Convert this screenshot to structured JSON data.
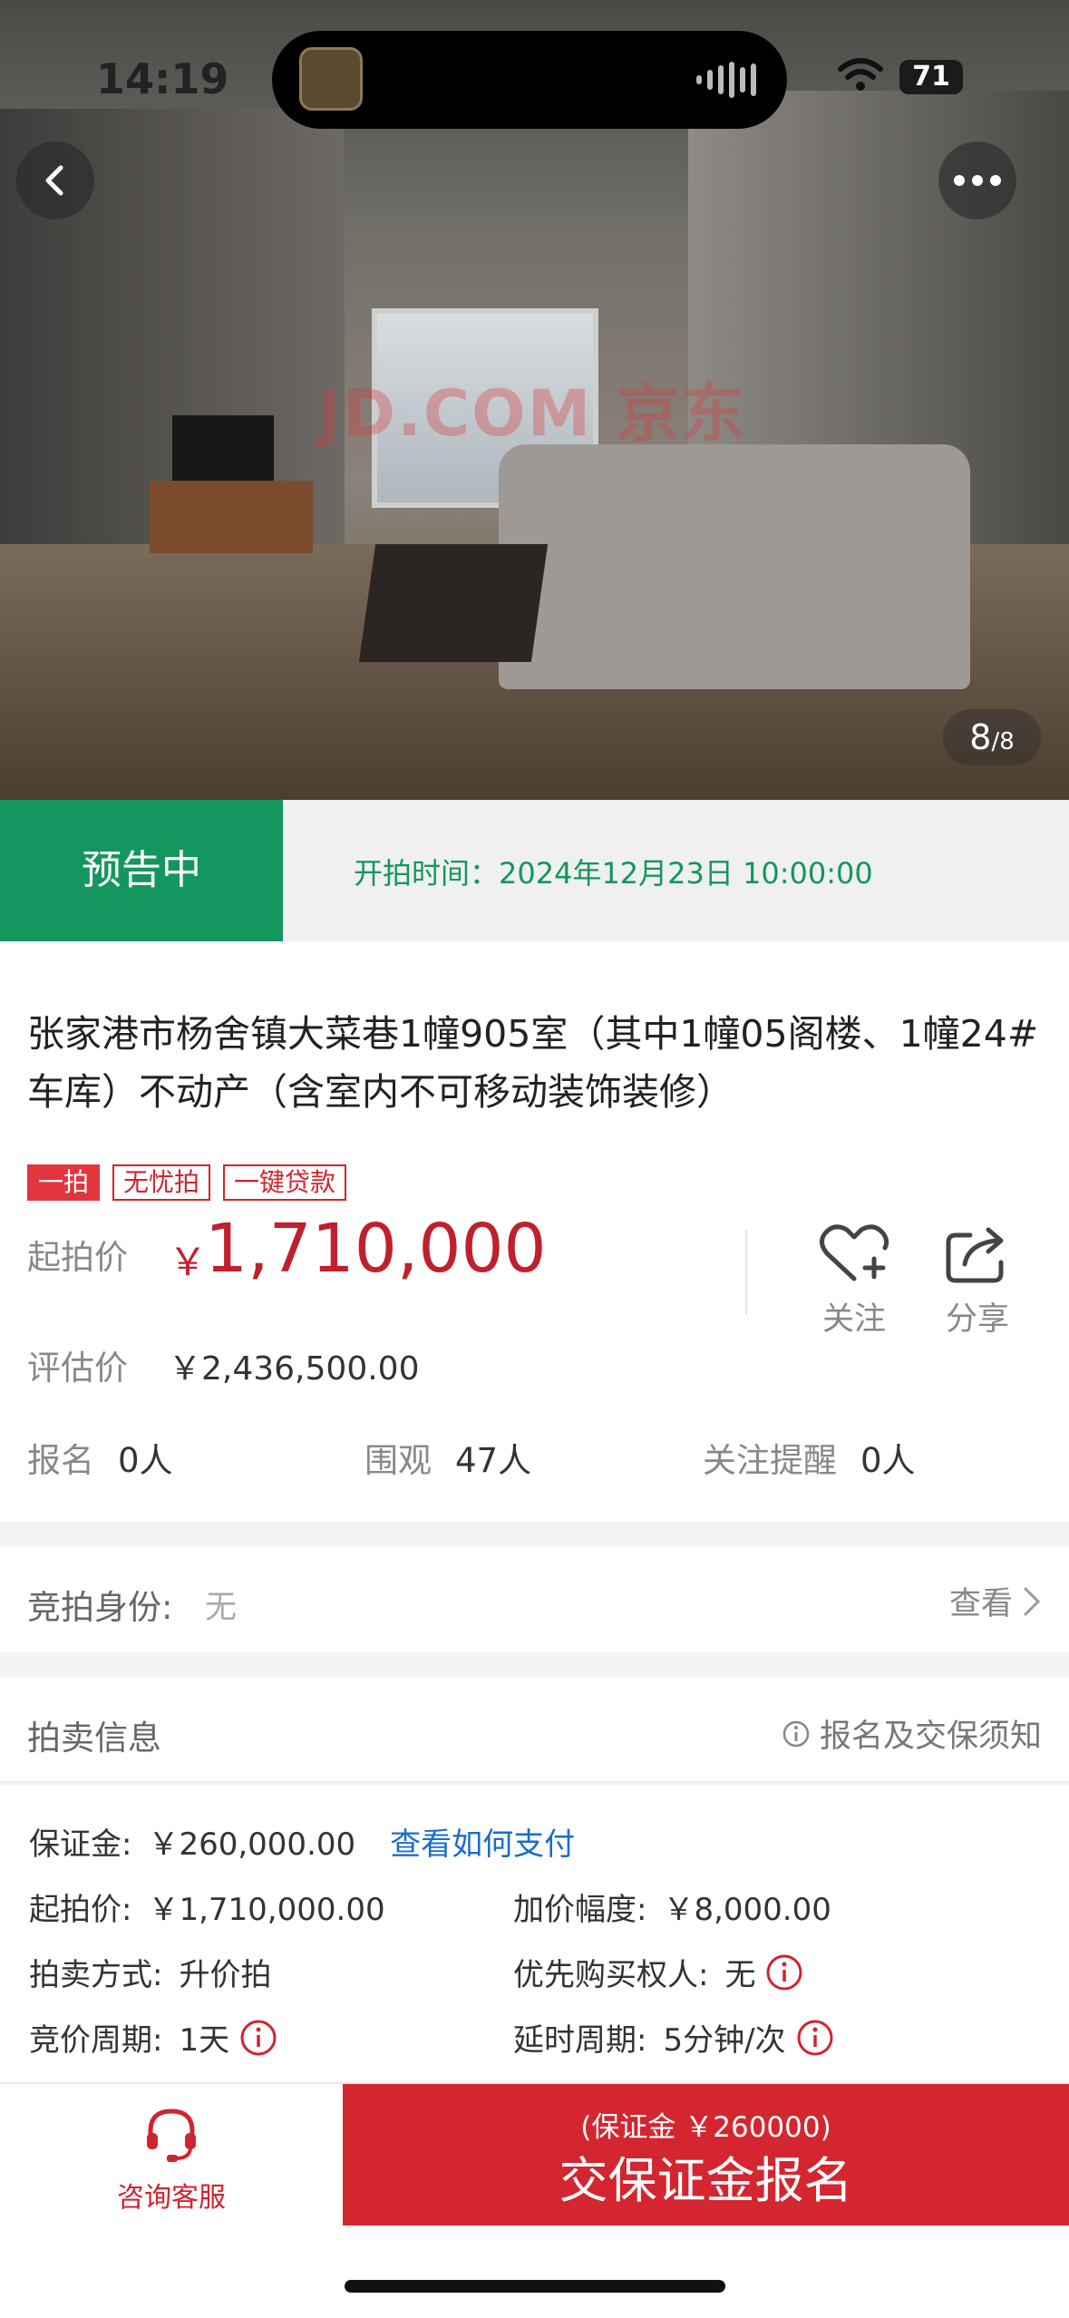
{
  "status_bar": {
    "time": "14:19",
    "battery": "71"
  },
  "gallery": {
    "current": "8",
    "total": "/8",
    "watermark": "JD.COM 京东"
  },
  "auction_status": {
    "label": "预告中",
    "start_time": "开拍时间：2024年12月23日 10:00:00"
  },
  "property": {
    "title": "张家港市杨舍镇大菜巷1幢905室（其中1幢05阁楼、1幢24#车库）不动产（含室内不可移动装饰装修）",
    "tags": [
      "一拍",
      "无忧拍",
      "一键贷款"
    ],
    "start_price_label": "起拍价",
    "currency": "￥",
    "start_price": "1,710,000",
    "eval_label": "评估价",
    "eval_price": "￥2,436,500.00"
  },
  "actions": {
    "follow": "关注",
    "share": "分享"
  },
  "stats": [
    {
      "label": "报名",
      "value": "0人"
    },
    {
      "label": "围观",
      "value": "47人"
    },
    {
      "label": "关注提醒",
      "value": "0人"
    }
  ],
  "identity": {
    "label": "竞拍身份:",
    "value": "无",
    "view": "查看"
  },
  "auction_info": {
    "title": "拍卖信息",
    "notice": "报名及交保须知",
    "deposit_label": "保证金:",
    "deposit_value": "￥260,000.00",
    "pay_link": "查看如何支付",
    "start_label": "起拍价:",
    "start_value": "￥1,710,000.00",
    "increment_label": "加价幅度:",
    "increment_value": "￥8,000.00",
    "method_label": "拍卖方式:",
    "method_value": "升价拍",
    "priority_label": "优先购买权人:",
    "priority_value": "无",
    "cycle_label": "竞价周期:",
    "cycle_value": "1天",
    "delay_label": "延时周期:",
    "delay_value": "5分钟/次"
  },
  "bottom": {
    "consult": "咨询客服",
    "deposit_sub": "(保证金 ￥260000)",
    "signup": "交保证金报名"
  },
  "colors": {
    "green": "#14965f",
    "red": "#d42630",
    "price_red": "#c0202c",
    "link_blue": "#1a6ec8"
  }
}
